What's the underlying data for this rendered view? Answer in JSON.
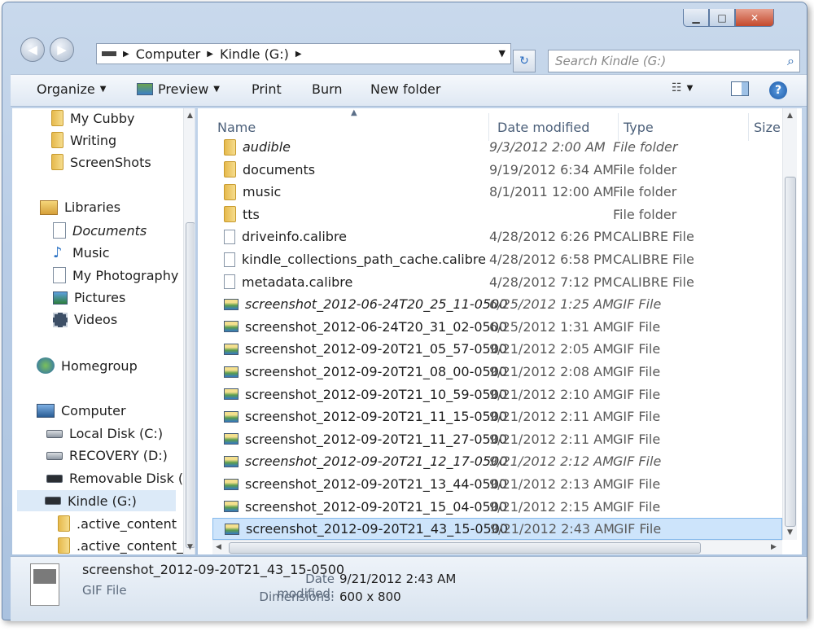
{
  "address": {
    "segments": [
      "Computer",
      "Kindle (G:)"
    ]
  },
  "search": {
    "placeholder": "Search Kindle (G:)"
  },
  "toolbar": {
    "organize": "Organize",
    "preview": "Preview",
    "print": "Print",
    "burn": "Burn",
    "new_folder": "New folder"
  },
  "nav": {
    "favorites": [
      "My Cubby",
      "Writing",
      "ScreenShots"
    ],
    "libraries_label": "Libraries",
    "libraries": [
      "Documents",
      "Music",
      "My Photography",
      "Pictures",
      "Videos"
    ],
    "homegroup": "Homegroup",
    "computer_label": "Computer",
    "drives": [
      "Local Disk (C:)",
      "RECOVERY (D:)",
      "Removable Disk (F:",
      "Kindle (G:)"
    ],
    "kindle_children": [
      ".active_content",
      ".active_content_s"
    ]
  },
  "columns": {
    "name": "Name",
    "date": "Date modified",
    "type": "Type",
    "size": "Size"
  },
  "files": [
    {
      "name": "audible",
      "date": "9/3/2012 2:00 AM",
      "type": "File folder",
      "kind": "folder"
    },
    {
      "name": "documents",
      "date": "9/19/2012 6:34 AM",
      "type": "File folder",
      "kind": "folder"
    },
    {
      "name": "music",
      "date": "8/1/2011 12:00 AM",
      "type": "File folder",
      "kind": "folder"
    },
    {
      "name": "tts",
      "date": "",
      "type": "File folder",
      "kind": "folder"
    },
    {
      "name": "driveinfo.calibre",
      "date": "4/28/2012 6:26 PM",
      "type": "CALIBRE File",
      "kind": "file"
    },
    {
      "name": "kindle_collections_path_cache.calibre",
      "date": "4/28/2012 6:58 PM",
      "type": "CALIBRE File",
      "kind": "file"
    },
    {
      "name": "metadata.calibre",
      "date": "4/28/2012 7:12 PM",
      "type": "CALIBRE File",
      "kind": "file"
    },
    {
      "name": "screenshot_2012-06-24T20_25_11-0500",
      "date": "6/25/2012 1:25 AM",
      "type": "GIF File",
      "kind": "gif"
    },
    {
      "name": "screenshot_2012-06-24T20_31_02-0500",
      "date": "6/25/2012 1:31 AM",
      "type": "GIF File",
      "kind": "gif"
    },
    {
      "name": "screenshot_2012-09-20T21_05_57-0500",
      "date": "9/21/2012 2:05 AM",
      "type": "GIF File",
      "kind": "gif"
    },
    {
      "name": "screenshot_2012-09-20T21_08_00-0500",
      "date": "9/21/2012 2:08 AM",
      "type": "GIF File",
      "kind": "gif"
    },
    {
      "name": "screenshot_2012-09-20T21_10_59-0500",
      "date": "9/21/2012 2:10 AM",
      "type": "GIF File",
      "kind": "gif"
    },
    {
      "name": "screenshot_2012-09-20T21_11_15-0500",
      "date": "9/21/2012 2:11 AM",
      "type": "GIF File",
      "kind": "gif"
    },
    {
      "name": "screenshot_2012-09-20T21_11_27-0500",
      "date": "9/21/2012 2:11 AM",
      "type": "GIF File",
      "kind": "gif"
    },
    {
      "name": "screenshot_2012-09-20T21_12_17-0500",
      "date": "9/21/2012 2:12 AM",
      "type": "GIF File",
      "kind": "gif"
    },
    {
      "name": "screenshot_2012-09-20T21_13_44-0500",
      "date": "9/21/2012 2:13 AM",
      "type": "GIF File",
      "kind": "gif"
    },
    {
      "name": "screenshot_2012-09-20T21_15_04-0500",
      "date": "9/21/2012 2:15 AM",
      "type": "GIF File",
      "kind": "gif"
    },
    {
      "name": "screenshot_2012-09-20T21_43_15-0500",
      "date": "9/21/2012 2:43 AM",
      "type": "GIF File",
      "kind": "gif"
    }
  ],
  "details": {
    "name": "screenshot_2012-09-20T21_43_15-0500",
    "type": "GIF File",
    "date_label": "Date modified:",
    "date_value": "9/21/2012 2:43 AM",
    "dim_label": "Dimensions:",
    "dim_value": "600 x 800"
  }
}
